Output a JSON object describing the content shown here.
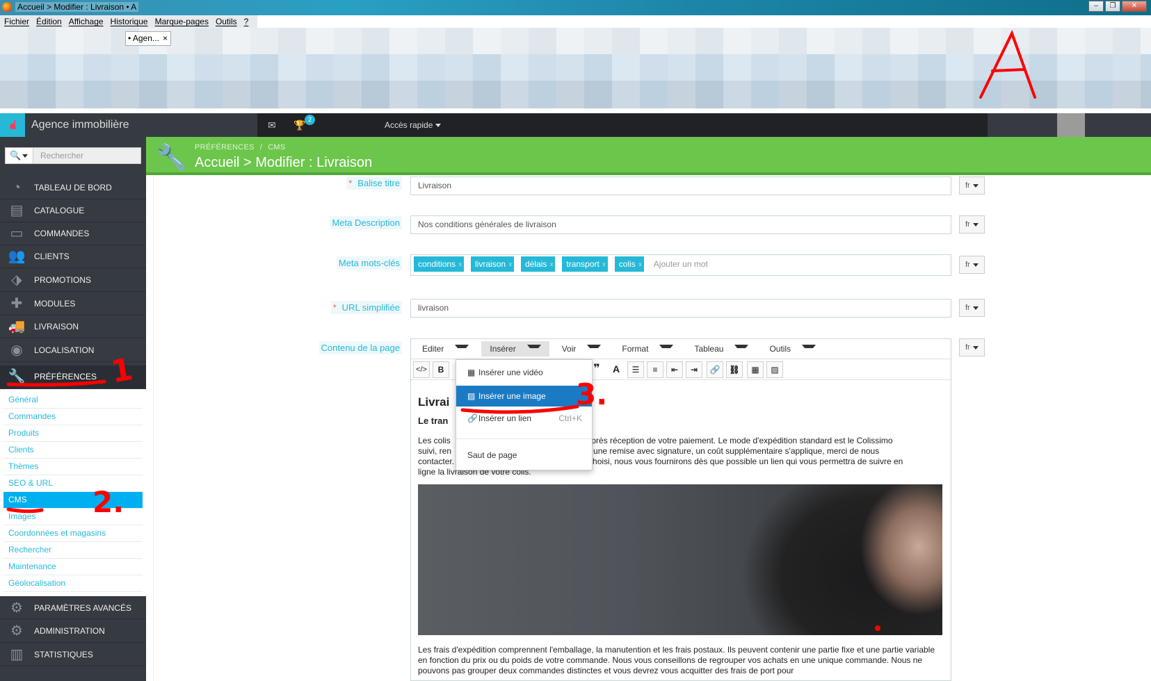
{
  "browser": {
    "window_title": "Accueil > Modifier : Livraison • A",
    "menu": [
      "Fichier",
      "Édition",
      "Affichage",
      "Historique",
      "Marque-pages",
      "Outils",
      "?"
    ],
    "tab_label": "• Agen...",
    "tab_close": "×"
  },
  "header": {
    "shop_name": "Agence immobilière",
    "notif_count": "2",
    "quick_access": "Accès rapide"
  },
  "sidebar": {
    "search_placeholder": "Rechercher",
    "items": [
      {
        "label": "TABLEAU DE BORD",
        "icon": "dashboard-icon"
      },
      {
        "label": "CATALOGUE",
        "icon": "book-icon"
      },
      {
        "label": "COMMANDES",
        "icon": "credit-card-icon"
      },
      {
        "label": "CLIENTS",
        "icon": "users-icon"
      },
      {
        "label": "PROMOTIONS",
        "icon": "tag-icon"
      },
      {
        "label": "MODULES",
        "icon": "puzzle-icon"
      },
      {
        "label": "LIVRAISON",
        "icon": "truck-icon"
      },
      {
        "label": "LOCALISATION",
        "icon": "globe-icon"
      },
      {
        "label": "PRÉFÉRENCES",
        "icon": "wrench-icon"
      }
    ],
    "submenu": [
      "Général",
      "Commandes",
      "Produits",
      "Clients",
      "Thèmes",
      "SEO & URL",
      "CMS",
      "Images",
      "Coordonnées et magasins",
      "Rechercher",
      "Maintenance",
      "Géolocalisation"
    ],
    "items_bottom": [
      {
        "label": "PARAMÈTRES AVANCÉS",
        "icon": "cogs-icon"
      },
      {
        "label": "ADMINISTRATION",
        "icon": "cog-icon"
      },
      {
        "label": "STATISTIQUES",
        "icon": "bar-chart-icon"
      }
    ]
  },
  "page": {
    "breadcrumb": [
      "PRÉFÉRENCES",
      "CMS"
    ],
    "breadcrumb_sep": "/",
    "title": "Accueil > Modifier : Livraison"
  },
  "form": {
    "lang": "fr",
    "title_tag": {
      "label": "Balise titre",
      "value": "Livraison",
      "required": "*"
    },
    "meta_description": {
      "label": "Meta Description",
      "value": "Nos conditions générales de livraison"
    },
    "meta_keywords": {
      "label": "Meta mots-clés",
      "tags": [
        "conditions",
        "livraison",
        "délais",
        "transport",
        "colis"
      ],
      "placeholder": "Ajouter un mot"
    },
    "friendly_url": {
      "label": "URL simplifiée",
      "value": "livraison",
      "required": "*"
    },
    "content": {
      "label": "Contenu de la page"
    }
  },
  "editor": {
    "menu": [
      "Editer",
      "Insérer",
      "Voir",
      "Format",
      "Tableau",
      "Outils"
    ],
    "toolbar": [
      "</>",
      "B",
      "❞",
      "A"
    ],
    "heading": "Livrai",
    "subheading": "Le tran",
    "para1_left": "Les colis",
    "para1_right": "h après réception de votre paiement. Le mode d'expédition standard est le Colissimo",
    "para1_line2_left": "suivi, ren",
    "para1_line2_right": "ez une remise avec signature, un coût supplémentaire s'applique, merci de nous",
    "para1_line3_left": "contacter.",
    "para1_line3_right": "n choisi, nous vous fournirons dès que possible un lien qui vous permettra de suivre en",
    "para1_line4": "ligne la livraison de votre colis.",
    "para2": "Les frais d'expédition comprennent l'emballage, la manutention et les frais postaux. Ils peuvent contenir une partie fixe et une partie variable en fonction du prix ou du poids de votre commande. Nous vous conseillons de regrouper vos achats en une unique commande. Nous ne pouvons pas grouper deux commandes distinctes et vous devrez vous acquitter des frais de port pour"
  },
  "insert_menu": {
    "items": [
      {
        "label": "Insérer une vidéo",
        "icon": "film-icon"
      },
      {
        "label": "Insérer une image",
        "icon": "image-icon"
      },
      {
        "label": "Insérer un lien",
        "icon": "link-icon",
        "shortcut": "Ctrl+K"
      },
      {
        "label": "Saut de page"
      }
    ]
  },
  "annotations": {
    "a": "A",
    "n1": "1",
    "n2": "2.",
    "n3": "3."
  },
  "colors": {
    "accent": "#25b9d7",
    "header_green": "#6cc64b",
    "sidebar": "#363a41",
    "highlight": "#1a7bc4",
    "annotation": "#ff0000"
  }
}
